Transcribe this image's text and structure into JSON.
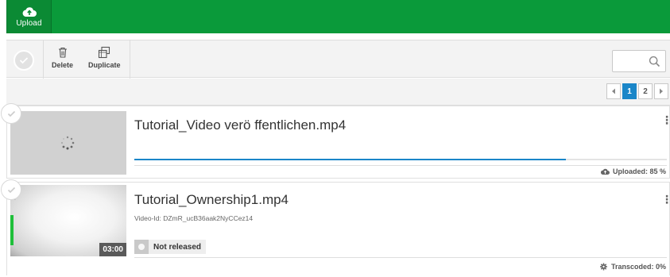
{
  "topbar": {
    "upload_label": "Upload"
  },
  "toolbar": {
    "delete_label": "Delete",
    "duplicate_label": "Duplicate",
    "search_placeholder": ""
  },
  "pagination": {
    "pages": [
      "1",
      "2"
    ],
    "active": "1"
  },
  "videos": [
    {
      "title": "Tutorial_Video verö ffentlichen.mp4",
      "status": "Uploaded: 85 %",
      "progress": 0.81
    },
    {
      "title": "Tutorial_Ownership1.mp4",
      "video_id": "Video-Id: DZmR_ucB36aak2NyCCez14",
      "duration": "03:00",
      "release": "Not released",
      "status": "Transcoded: 0%"
    }
  ],
  "colors": {
    "accent": "#0a9a3a",
    "progress": "#1a86c8"
  }
}
